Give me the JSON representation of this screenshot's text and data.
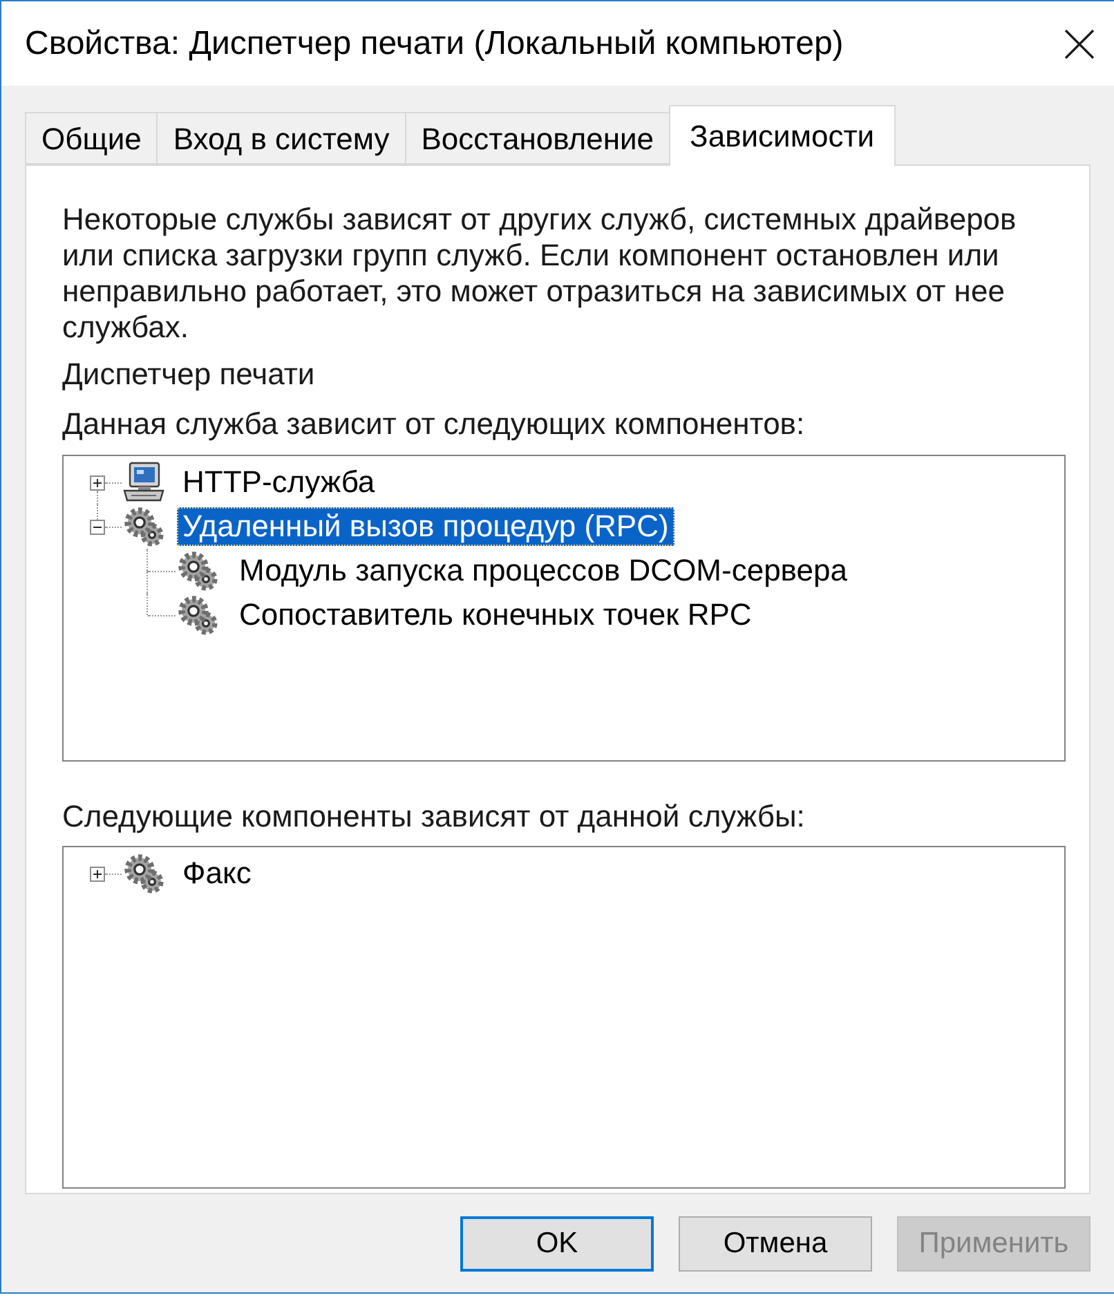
{
  "window": {
    "title": "Свойства: Диспетчер печати (Локальный компьютер)"
  },
  "tabs": [
    {
      "label": "Общие",
      "selected": false
    },
    {
      "label": "Вход в систему",
      "selected": false
    },
    {
      "label": "Восстановление",
      "selected": false
    },
    {
      "label": "Зависимости",
      "selected": true
    }
  ],
  "description": "Некоторые службы зависят от других служб, системных драйверов или списка загрузки групп служб. Если компонент остановлен или неправильно работает, это может отразиться на зависимых от нее службах.",
  "service_name": "Диспетчер печати",
  "depends_on": {
    "label": "Данная служба зависит от следующих компонентов:",
    "items": [
      {
        "label": "HTTP-служба",
        "kind": "computer",
        "expanded": false,
        "selected": false
      },
      {
        "label": "Удаленный вызов процедур (RPC)",
        "kind": "gear",
        "expanded": true,
        "selected": true,
        "children": [
          {
            "label": "Модуль запуска процессов DCOM-сервера",
            "kind": "gear",
            "selected": false
          },
          {
            "label": "Сопоставитель конечных точек RPC",
            "kind": "gear",
            "selected": false
          }
        ]
      }
    ]
  },
  "dependents": {
    "label": "Следующие компоненты зависят от данной службы:",
    "items": [
      {
        "label": "Факс",
        "kind": "gear",
        "expanded": false,
        "selected": false
      }
    ]
  },
  "buttons": [
    {
      "label": "OK",
      "kind": "default",
      "disabled": false
    },
    {
      "label": "Отмена",
      "kind": "normal",
      "disabled": false
    },
    {
      "label": "Применить",
      "kind": "normal",
      "disabled": true
    }
  ]
}
